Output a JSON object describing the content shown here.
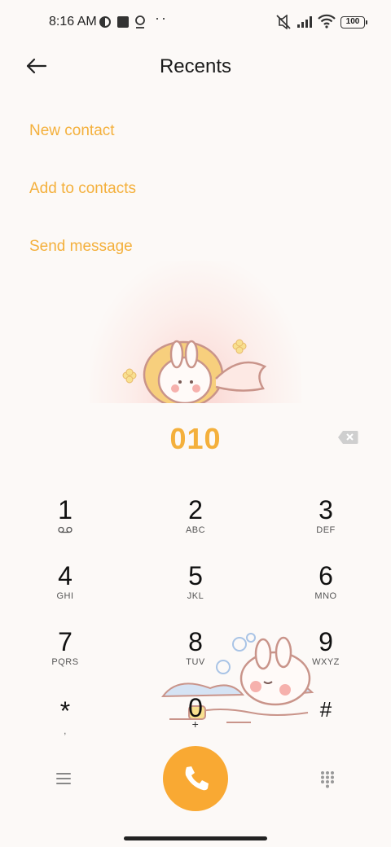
{
  "status_bar": {
    "time": "8:16 AM",
    "battery": "100",
    "icons": [
      "vpn-icon",
      "square-icon",
      "location-icon",
      "more-dots-icon",
      "mute-icon",
      "signal-icon",
      "wifi-icon",
      "battery-icon"
    ],
    "more": "··"
  },
  "header": {
    "title": "Recents",
    "back_icon": "back-arrow-icon"
  },
  "actions": [
    {
      "label": "New contact"
    },
    {
      "label": "Add to contacts"
    },
    {
      "label": "Send message"
    }
  ],
  "accent_color": "#f4b03c",
  "call_color": "#f9a933",
  "dialed_number": "010",
  "keys": [
    {
      "digit": "1",
      "letters": "",
      "icon": "voicemail-icon"
    },
    {
      "digit": "2",
      "letters": "ABC"
    },
    {
      "digit": "3",
      "letters": "DEF"
    },
    {
      "digit": "4",
      "letters": "GHI"
    },
    {
      "digit": "5",
      "letters": "JKL"
    },
    {
      "digit": "6",
      "letters": "MNO"
    },
    {
      "digit": "7",
      "letters": "PQRS"
    },
    {
      "digit": "8",
      "letters": "TUV"
    },
    {
      "digit": "9",
      "letters": "WXYZ"
    },
    {
      "digit": "*",
      "letters": ","
    },
    {
      "digit": "0",
      "letters": "+"
    },
    {
      "digit": "#",
      "letters": ""
    }
  ],
  "bottom_bar": {
    "menu_icon": "menu-icon",
    "call_icon": "phone-icon",
    "dialpad_icon": "dialpad-icon"
  }
}
